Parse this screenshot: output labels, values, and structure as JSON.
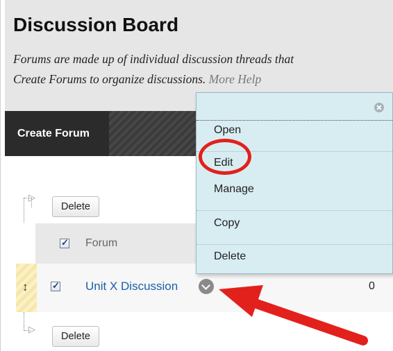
{
  "header": {
    "title": "Discussion Board",
    "desc_line1": "Forums are made up of individual discussion threads that",
    "desc_line2": "Create Forums to organize discussions.",
    "more_help": "More Help"
  },
  "actionbar": {
    "create_forum": "Create Forum"
  },
  "list": {
    "delete_label": "Delete",
    "column_forum": "Forum",
    "rows": [
      {
        "name": "Unit X Discussion",
        "count": "0",
        "checked": true
      }
    ]
  },
  "context_menu": {
    "items": [
      "Open",
      "Edit",
      "Manage",
      "Copy",
      "Delete"
    ]
  },
  "annotation": {
    "highlight_color": "#e2211c"
  },
  "icons": [
    "close-icon",
    "chevron-down-icon",
    "drag-handle-icon",
    "checkbox-icon",
    "tree-arrow-icon",
    "pointer-arrow-icon"
  ]
}
